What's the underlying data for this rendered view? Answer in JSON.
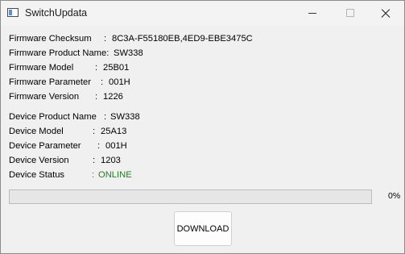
{
  "window": {
    "title": "SwitchUpdata"
  },
  "firmware": {
    "checksum_label": "Firmware Checksum",
    "checksum_sep": ":",
    "checksum_value": "8C3A-F55180EB,4ED9-EBE3475C",
    "product_name_label": "Firmware Product Name:",
    "product_name_value": "SW338",
    "model_label": "Firmware Model",
    "model_sep": ":",
    "model_value": "25B01",
    "parameter_label": "Firmware Parameter",
    "parameter_sep": ":",
    "parameter_value": "001H",
    "version_label": "Firmware Version",
    "version_sep": ":",
    "version_value": "1226"
  },
  "device": {
    "product_name_label": "Device Product Name",
    "product_name_sep": ":",
    "product_name_value": "SW338",
    "model_label": "Device Model",
    "model_sep": ":",
    "model_value": "25A13",
    "parameter_label": "Device Parameter",
    "parameter_sep": ":",
    "parameter_value": "001H",
    "version_label": "Device Version",
    "version_sep": ":",
    "version_value": "1203",
    "status_label": "Device Status",
    "status_sep": ":",
    "status_value": "ONLINE",
    "status_color": "#178a17"
  },
  "progress": {
    "value": 0,
    "label": "0%"
  },
  "download_label": "DOWNLOAD"
}
